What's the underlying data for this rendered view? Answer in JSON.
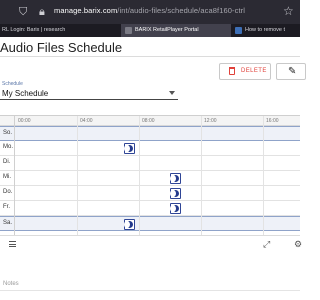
{
  "browser": {
    "url_host": "manage.barix.com",
    "url_path": "/int/audio-files/schedule/aca8f160-ctrl",
    "tabs": [
      {
        "label": "RL Login: Barix | research"
      },
      {
        "label": "BARIX RetailPlayer Portal"
      },
      {
        "label": "How to remove t"
      }
    ]
  },
  "header": {
    "title": "Audio Files Schedule",
    "delete_label": "DELETE"
  },
  "schedule": {
    "label": "Schedule",
    "value": "My Schedule"
  },
  "grid": {
    "hours": [
      "00:00",
      "04:00",
      "08:00",
      "12:00",
      "16:00"
    ],
    "days": [
      {
        "label": "So.",
        "highlight": true
      },
      {
        "label": "Mo.",
        "highlight": false
      },
      {
        "label": "Di.",
        "highlight": false
      },
      {
        "label": "Mi.",
        "highlight": false
      },
      {
        "label": "Do.",
        "highlight": false
      },
      {
        "label": "Fr.",
        "highlight": false
      },
      {
        "label": "Sa.",
        "highlight": true
      }
    ]
  },
  "notes": {
    "label": "Notes"
  },
  "colors": {
    "accent": "#243a8c",
    "delete": "#e0413a",
    "chrome": "#2b2a33"
  }
}
